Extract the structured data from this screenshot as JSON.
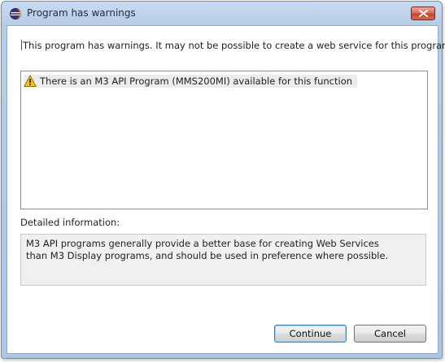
{
  "window": {
    "title": "Program has warnings",
    "close_icon": "close-x-icon",
    "app_icon": "eclipse-icon"
  },
  "message": "This program has warnings. It may not be possible to create a web service for this program:",
  "warnings": [
    {
      "icon": "warning-triangle-icon",
      "text": "There is an M3 API Program (MMS200MI) available for this function"
    }
  ],
  "details": {
    "label": "Detailed information:",
    "lines": [
      "M3 API programs generally provide a better base for creating Web Services",
      "than M3 Display programs, and should be used in preference where possible."
    ]
  },
  "buttons": {
    "continue": "Continue",
    "cancel": "Cancel"
  }
}
